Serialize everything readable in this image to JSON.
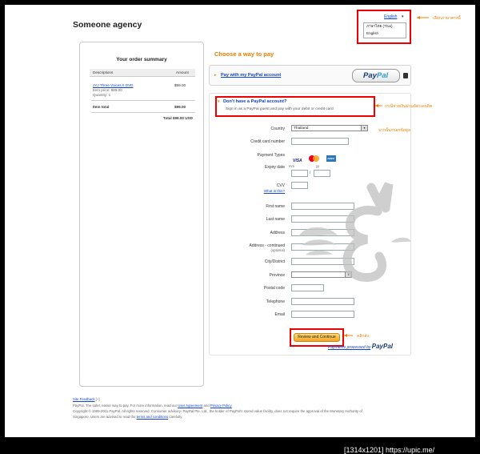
{
  "merchant": "Someone agency",
  "language": {
    "selected": "English",
    "caret": "▾",
    "options": [
      "ภาษาไทย (Thai)",
      "English"
    ],
    "annotation": "เลือกภาษาตรงนี้"
  },
  "summary": {
    "title": "Your order summary",
    "col_desc": "Descriptions",
    "col_amount": "Amount",
    "item_name": "JYJ Three Voices II DVD",
    "item_amount": "$99.00",
    "item_price": "Item price: $99.00",
    "item_qty": "Quantity: 1",
    "total_label": "Item total",
    "total_amount": "$99.00",
    "grand_total": "Total $99.00 USD"
  },
  "choose_heading": "Choose a way to pay",
  "paypal_account": {
    "link": "Pay with my PayPal account",
    "logo_pay": "Pay",
    "logo_pal": "Pal"
  },
  "guest": {
    "title": "Don't have a PayPal account?",
    "desc": "Sign in as a PayPal guest and pay with your debit or credit card",
    "annotation": "กรณีจ่ายเงินผ่านบัตรเครดิต",
    "annotation2": "จากนั้นกรอกข้อมูล"
  },
  "form": {
    "country_label": "Country",
    "country_value": "Thailand",
    "card_number_label": "Credit card number",
    "payment_types_label": "Payment Types",
    "card_visa": "VISA",
    "card_mc": "MC",
    "card_amex": "AMEX",
    "expiry_label": "Expiry date",
    "expiry_mm": "mm",
    "expiry_yy": "yy",
    "expiry_sep": "/",
    "cvv_label": "CVV",
    "cvv_help": "What is this?",
    "first_name_label": "First name",
    "last_name_label": "Last name",
    "address_label": "Address",
    "address2_label": "Address - continued",
    "optional": "(optional)",
    "city_label": "City/District",
    "province_label": "Province",
    "postal_label": "Postal code",
    "phone_label": "Telephone",
    "email_label": "Email",
    "review_button": "Review and Continue",
    "review_annotation": "คลิกส่ง",
    "processed_by": "Payments processed by",
    "processed_logo": "PayPal"
  },
  "footer": {
    "feedback": "Site Feedback",
    "feedback_suffix": "[+]",
    "line1_prefix": "PayPal. The safer, easier way to pay. For more information, read our",
    "user_agreement": "User Agreement",
    "and": "and",
    "privacy": "Privacy Policy",
    "line2": "Copyright © 1999-2011 PayPal. All rights reserved. Consumer advisory- PayPal Pte. Ltd., the holder of PayPal's stored value facility, does not require the approval of the Monetary Authority of",
    "line3_prefix": "Singapore. Users are advised to read the",
    "terms": "terms and conditions",
    "line3_suffix": "carefully."
  },
  "watermark": "[1314x1201] https://upic.me/"
}
